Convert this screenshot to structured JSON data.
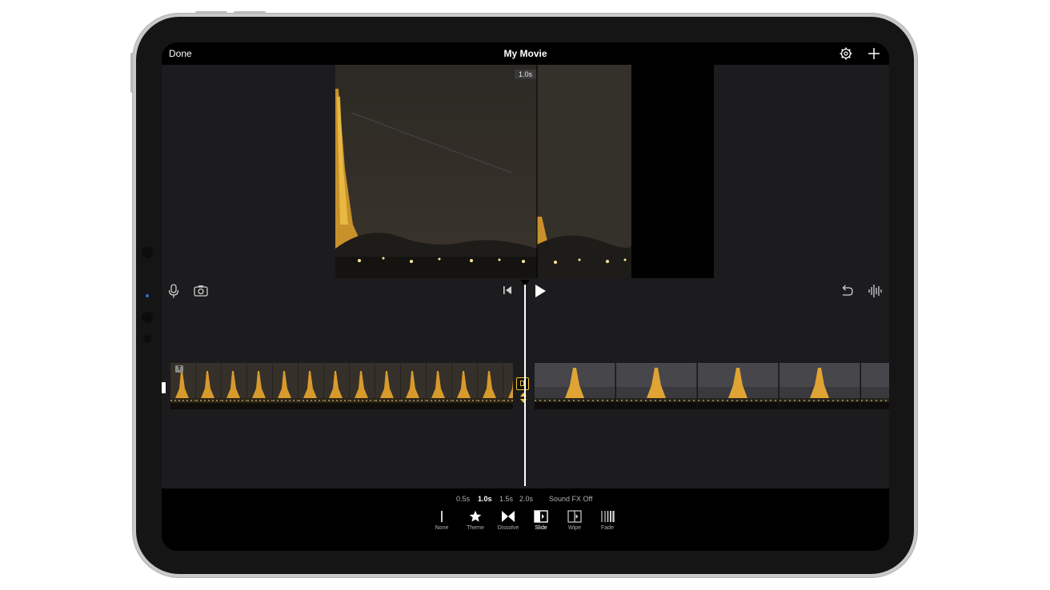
{
  "navbar": {
    "done_label": "Done",
    "title": "My Movie",
    "settings_icon": "gear-icon",
    "add_icon": "plus-icon"
  },
  "viewer": {
    "duration_badge": "1.0s"
  },
  "toolbar": {
    "icons": [
      "microphone-icon",
      "camera-icon",
      "skip-to-start-icon",
      "play-icon",
      "undo-icon",
      "audio-waveform-icon"
    ]
  },
  "timeline": {
    "title_badge": "T"
  },
  "inspector": {
    "durations": [
      "0.5s",
      "1.0s",
      "1.5s",
      "2.0s"
    ],
    "selected_duration": "1.0s",
    "sound_fx_label": "Sound FX Off",
    "transitions": [
      {
        "label": "None",
        "icon": "none-transition-icon"
      },
      {
        "label": "Theme",
        "icon": "star-icon"
      },
      {
        "label": "Dissolve",
        "icon": "dissolve-icon"
      },
      {
        "label": "Slide",
        "icon": "slide-icon"
      },
      {
        "label": "Wipe",
        "icon": "wipe-icon"
      },
      {
        "label": "Fade",
        "icon": "fade-icon"
      }
    ],
    "selected_transition": "Slide"
  },
  "colors": {
    "accent_yellow": "#f2c230",
    "screen_bg": "#1c1c1e",
    "bar_bg": "#000000"
  }
}
